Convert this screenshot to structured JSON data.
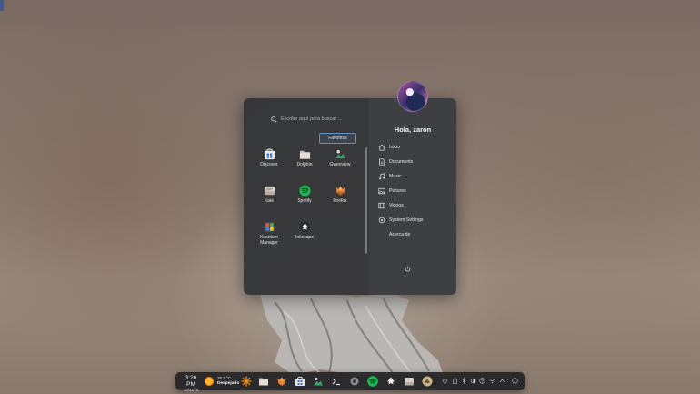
{
  "launcher": {
    "search_placeholder": "Escribe aquí para buscar ...",
    "favorites_tab": "Favoritos",
    "apps": [
      {
        "label": "Discover"
      },
      {
        "label": "Dolphin"
      },
      {
        "label": "Gwenview"
      },
      {
        "label": "Kate"
      },
      {
        "label": "Spotify"
      },
      {
        "label": "Firefox"
      },
      {
        "label": "Kvantum Manager"
      },
      {
        "label": "Inkscape"
      }
    ],
    "greeting": "Hola, zaron",
    "places": [
      {
        "label": "Inicio",
        "icon": "home-icon"
      },
      {
        "label": "Documents",
        "icon": "document-icon"
      },
      {
        "label": "Music",
        "icon": "music-icon"
      },
      {
        "label": "Pictures",
        "icon": "pictures-icon"
      },
      {
        "label": "Videos",
        "icon": "video-icon"
      },
      {
        "label": "System Settings",
        "icon": "settings-icon"
      },
      {
        "label": "Acerca de",
        "icon": ""
      }
    ]
  },
  "taskbar": {
    "time": "3:26 PM",
    "date": "10/03/25",
    "temperature": "25.2 °C",
    "weather": "Despejado",
    "apps": [
      "launcher-icon",
      "files-icon",
      "firefox-icon",
      "gwenview-icon",
      "terminal-icon",
      "settings-icon",
      "store-icon",
      "spotify-icon",
      "inkscape-icon",
      "kate-icon",
      "app-icon"
    ],
    "tray": [
      "bug-icon",
      "clipboard-icon",
      "bluetooth-icon",
      "brightness-icon",
      "help-icon",
      "wifi-icon",
      "chevron-up-icon",
      "power-icon"
    ]
  },
  "colors": {
    "panel_bg": "#343538",
    "accent": "#6b8fbf",
    "spotify": "#1db954"
  }
}
